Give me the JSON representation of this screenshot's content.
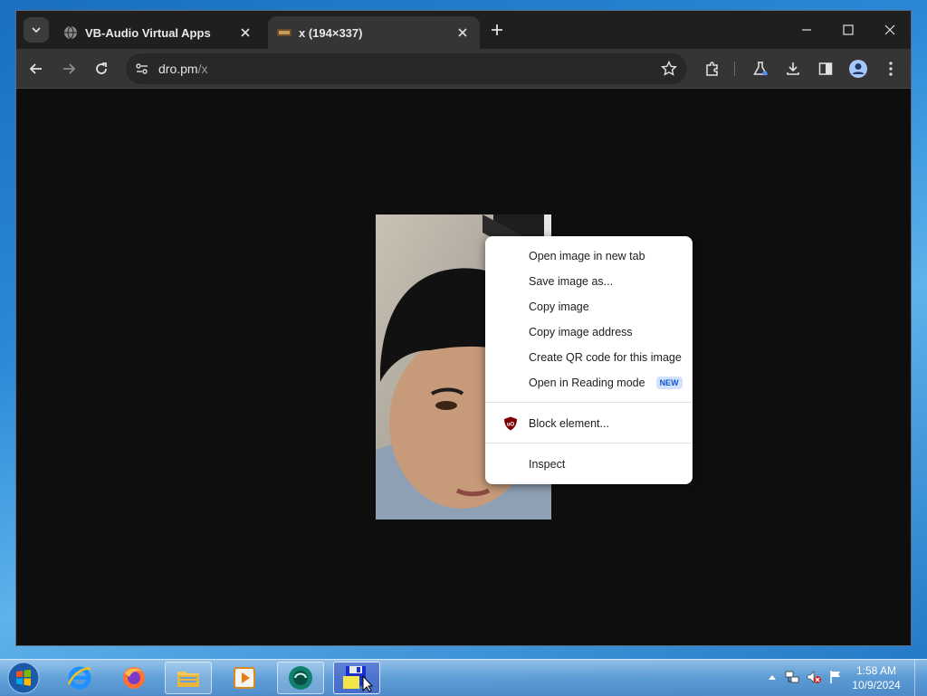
{
  "browser": {
    "tabs": [
      {
        "title": "VB-Audio Virtual Apps",
        "favicon": "globe-icon",
        "active": false
      },
      {
        "title": "x (194×337)",
        "favicon": "image-icon",
        "active": true
      }
    ],
    "address": {
      "domain": "dro.pm",
      "path": "/x"
    }
  },
  "image": {
    "alt": "x (194×337)"
  },
  "context_menu": {
    "items": [
      {
        "label": "Open image in new tab"
      },
      {
        "label": "Save image as..."
      },
      {
        "label": "Copy image"
      },
      {
        "label": "Copy image address"
      },
      {
        "label": "Create QR code for this image"
      },
      {
        "label": "Open in Reading mode",
        "badge": "NEW"
      },
      {
        "label": "Block element...",
        "icon": "ublock-origin-icon"
      },
      {
        "label": "Inspect"
      }
    ]
  },
  "taskbar": {
    "apps": [
      "internet-explorer-icon",
      "firefox-icon",
      "file-explorer-icon",
      "media-player-icon",
      "app-icon",
      "save-app-icon"
    ],
    "clock": {
      "time": "1:58 AM",
      "date": "10/9/2024"
    }
  },
  "colors": {
    "menu_badge_bg": "#d3e3fd",
    "menu_badge_text": "#0b57d0",
    "ublock_red": "#800000"
  }
}
